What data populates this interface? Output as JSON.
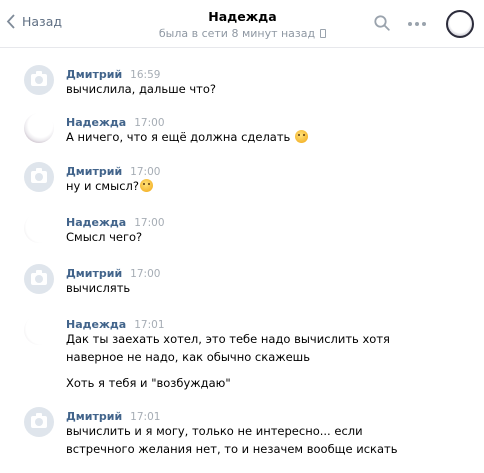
{
  "header": {
    "back_label": "Назад",
    "title": "Надежда",
    "status": "была в сети 8 минут назад"
  },
  "messages": [
    {
      "author": "Дмитрий",
      "time": "16:59",
      "avatar": "camera-placeholder",
      "lines": [
        "вычислила, дальше что?"
      ]
    },
    {
      "author": "Надежда",
      "time": "17:00",
      "avatar": "photo",
      "lines": [
        "А ничего, что я ещё должна сделать"
      ],
      "emoji": "thinking-face"
    },
    {
      "author": "Дмитрий",
      "time": "17:00",
      "avatar": "camera-placeholder",
      "lines": [
        "ну и смысл?"
      ],
      "emoji": "thinking-face"
    },
    {
      "author": "Надежда",
      "time": "17:00",
      "avatar": "photo",
      "lines": [
        "Смысл чего?"
      ]
    },
    {
      "author": "Дмитрий",
      "time": "17:00",
      "avatar": "camera-placeholder",
      "lines": [
        "вычислять"
      ]
    },
    {
      "author": "Надежда",
      "time": "17:01",
      "avatar": "photo",
      "lines": [
        "Дак ты заехать хотел, это тебе надо вычислить хотя наверное не надо, как обычно скажешь",
        "Хоть я тебя и \"возбуждаю\""
      ]
    },
    {
      "author": "Дмитрий",
      "time": "17:01",
      "avatar": "camera-placeholder",
      "lines": [
        "вычислить и я могу, только не интересно... если встречного желания нет, то и незачем вообще искать"
      ]
    }
  ],
  "colors": {
    "author": "#42648b",
    "time": "#a6adb5",
    "back": "#5f6f83",
    "status": "#8f98a3",
    "divider": "#e7e8ec"
  }
}
